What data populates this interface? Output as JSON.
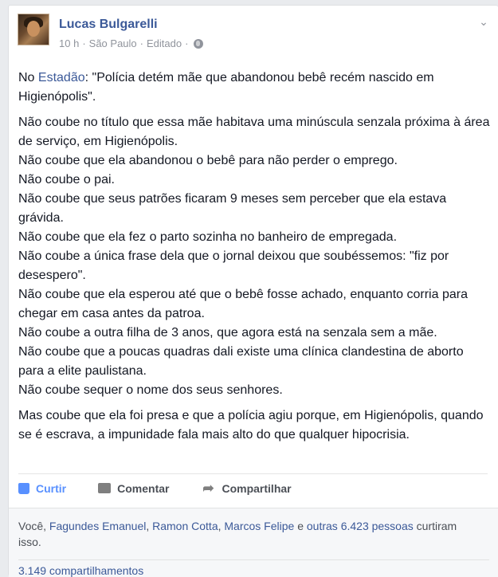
{
  "post": {
    "author": "Lucas Bulgarelli",
    "time": "10 h",
    "location": "São Paulo",
    "edited": "Editado",
    "paragraphs": [
      [
        "No ",
        "Estadão",
        ": \"Polícia detém mãe que abandonou bebê recém nascido em Higienópolis\"."
      ],
      "Não coube no título que essa mãe habitava uma minúscula senzala próxima à área de serviço, em Higienópolis.",
      "Não coube que ela abandonou o bebê para não perder o emprego.",
      "Não coube o pai.",
      "Não coube que seus patrões ficaram 9 meses sem perceber que ela estava grávida.",
      "Não coube que ela fez o parto sozinha no banheiro de empregada.",
      "Não coube a única frase dela que o jornal deixou que soubéssemos: \"fiz por desespero\".",
      "Não coube que ela esperou até que o bebê fosse achado, enquanto corria para chegar em casa antes da patroa.",
      "Não coube a outra filha de 3 anos, que agora está na senzala sem a mãe.",
      "Não coube que a poucas quadras dali existe uma clínica clandestina de aborto para a elite paulistana.",
      "Não coube sequer o nome dos seus senhores.",
      "Mas coube que ela foi presa e que a polícia agiu porque, em Higienópolis, quando se é escrava, a impunidade fala mais alto do que qualquer hipocrisia."
    ]
  },
  "intro": {
    "prefix": "No ",
    "link": "Estadão",
    "suffix": ": \"Polícia detém mãe que abandonou bebê recém nascido em Higienópolis\"."
  },
  "lines": [
    "Não coube no título que essa mãe habitava uma minúscula senzala próxima à área de serviço, em Higienópolis.",
    "Não coube que ela abandonou o bebê para não perder o emprego.",
    "Não coube o pai.",
    "Não coube que seus patrões ficaram 9 meses sem perceber que ela estava grávida.",
    "Não coube que ela fez o parto sozinha no banheiro de empregada.",
    "Não coube a única frase dela que o jornal deixou que soubéssemos: \"fiz por desespero\".",
    "Não coube que ela esperou até que o bebê fosse achado, enquanto corria para chegar em casa antes da patroa.",
    "Não coube a outra filha de 3 anos, que agora está na senzala sem a mãe.",
    "Não coube que a poucas quadras dali existe uma clínica clandestina de aborto para a elite paulistana.",
    "Não coube sequer o nome dos seus senhores."
  ],
  "closing": "Mas coube que ela foi presa e que a polícia agiu porque, em Higienópolis, quando se é escrava, a impunidade fala mais alto do que qualquer hipocrisia.",
  "actions": {
    "like": "Curtir",
    "comment": "Comentar",
    "share": "Compartilhar"
  },
  "likes": {
    "you": "Você,",
    "name1": "Fagundes Emanuel",
    "name2": "Ramon Cotta",
    "name3": "Marcos Felipe",
    "and": " e ",
    "others": "outras 6.423 pessoas",
    "suffix": " curtiram isso."
  },
  "shares": "3.149 compartilhamentos",
  "icons": [
    "chevron-down-icon",
    "globe-icon",
    "like-icon",
    "comment-icon",
    "share-icon"
  ],
  "colors": {
    "link": "#3b5998",
    "like_active": "#5890ff",
    "meta": "#90949c"
  }
}
